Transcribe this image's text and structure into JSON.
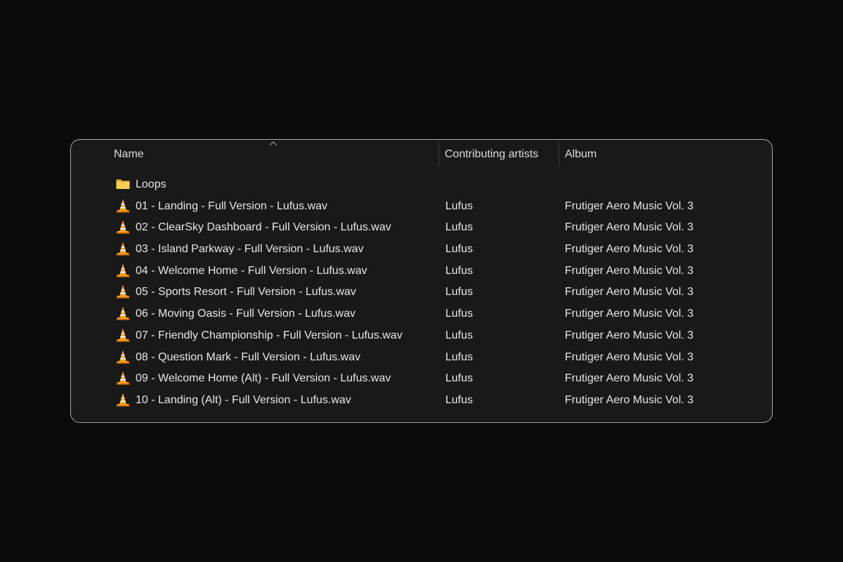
{
  "columns": {
    "name": "Name",
    "artists": "Contributing artists",
    "album": "Album",
    "sort_icon": "chevron-up-icon"
  },
  "folder": {
    "name": "Loops",
    "icon": "folder-icon"
  },
  "files": [
    {
      "name": "01 - Landing - Full Version - Lufus.wav",
      "artist": "Lufus",
      "album": "Frutiger Aero Music Vol. 3",
      "icon": "vlc-cone-icon"
    },
    {
      "name": "02 - ClearSky Dashboard - Full Version - Lufus.wav",
      "artist": "Lufus",
      "album": "Frutiger Aero Music Vol. 3",
      "icon": "vlc-cone-icon"
    },
    {
      "name": "03 - Island Parkway - Full Version - Lufus.wav",
      "artist": "Lufus",
      "album": "Frutiger Aero Music Vol. 3",
      "icon": "vlc-cone-icon"
    },
    {
      "name": "04 - Welcome Home - Full Version - Lufus.wav",
      "artist": "Lufus",
      "album": "Frutiger Aero Music Vol. 3",
      "icon": "vlc-cone-icon"
    },
    {
      "name": "05 - Sports Resort - Full Version - Lufus.wav",
      "artist": "Lufus",
      "album": "Frutiger Aero Music Vol. 3",
      "icon": "vlc-cone-icon"
    },
    {
      "name": "06 - Moving Oasis - Full Version - Lufus.wav",
      "artist": "Lufus",
      "album": "Frutiger Aero Music Vol. 3",
      "icon": "vlc-cone-icon"
    },
    {
      "name": "07 - Friendly Championship - Full Version - Lufus.wav",
      "artist": "Lufus",
      "album": "Frutiger Aero Music Vol. 3",
      "icon": "vlc-cone-icon"
    },
    {
      "name": "08 - Question Mark - Full Version - Lufus.wav",
      "artist": "Lufus",
      "album": "Frutiger Aero Music Vol. 3",
      "icon": "vlc-cone-icon"
    },
    {
      "name": "09 - Welcome Home (Alt) - Full Version - Lufus.wav",
      "artist": "Lufus",
      "album": "Frutiger Aero Music Vol. 3",
      "icon": "vlc-cone-icon"
    },
    {
      "name": "10 - Landing (Alt) - Full Version - Lufus.wav",
      "artist": "Lufus",
      "album": "Frutiger Aero Music Vol. 3",
      "icon": "vlc-cone-icon"
    }
  ],
  "colors": {
    "background": "#0b0b0b",
    "panel": "#191919",
    "panel_border": "#a9a9a9",
    "text": "#e6e6e6",
    "folder": "#f4c542",
    "cone_orange": "#f08a00"
  }
}
